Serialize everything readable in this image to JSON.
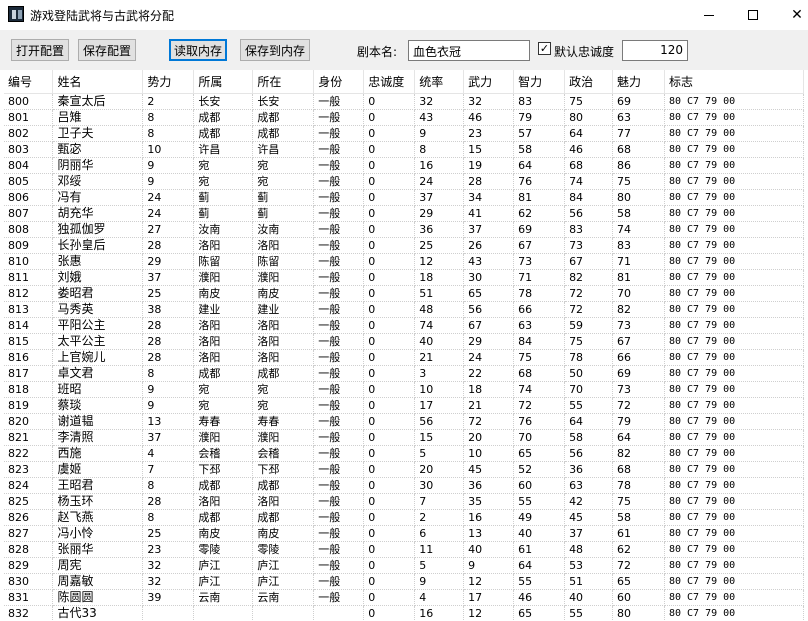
{
  "window": {
    "title": "游戏登陆武将与古武将分配"
  },
  "toolbar": {
    "open_config": "打开配置",
    "save_config": "保存配置",
    "read_memory": "读取内存",
    "save_to_memory": "保存到内存",
    "script_label": "剧本名:",
    "script_value": "血色衣冠",
    "default_loyalty_label": "默认忠诚度",
    "default_loyalty_checked": "✓",
    "default_loyalty_value": "120"
  },
  "table": {
    "columns": [
      "编号",
      "姓名",
      "势力",
      "所属",
      "所在",
      "身份",
      "忠诚度",
      "统率",
      "武力",
      "智力",
      "政治",
      "魅力",
      "标志"
    ],
    "rows": [
      [
        "800",
        "秦宣太后",
        "2",
        "长安",
        "长安",
        "一般",
        "0",
        "32",
        "32",
        "83",
        "75",
        "69",
        "80 C7 79 00"
      ],
      [
        "801",
        "吕雉",
        "8",
        "成都",
        "成都",
        "一般",
        "0",
        "43",
        "46",
        "79",
        "80",
        "63",
        "80 C7 79 00"
      ],
      [
        "802",
        "卫子夫",
        "8",
        "成都",
        "成都",
        "一般",
        "0",
        "9",
        "23",
        "57",
        "64",
        "77",
        "80 C7 79 00"
      ],
      [
        "803",
        "甄宓",
        "10",
        "许昌",
        "许昌",
        "一般",
        "0",
        "8",
        "15",
        "58",
        "46",
        "68",
        "80 C7 79 00"
      ],
      [
        "804",
        "阴丽华",
        "9",
        "宛",
        "宛",
        "一般",
        "0",
        "16",
        "19",
        "64",
        "68",
        "86",
        "80 C7 79 00"
      ],
      [
        "805",
        "邓绥",
        "9",
        "宛",
        "宛",
        "一般",
        "0",
        "24",
        "28",
        "76",
        "74",
        "75",
        "80 C7 79 00"
      ],
      [
        "806",
        "冯有",
        "24",
        "蓟",
        "蓟",
        "一般",
        "0",
        "37",
        "34",
        "81",
        "84",
        "80",
        "80 C7 79 00"
      ],
      [
        "807",
        "胡充华",
        "24",
        "蓟",
        "蓟",
        "一般",
        "0",
        "29",
        "41",
        "62",
        "56",
        "58",
        "80 C7 79 00"
      ],
      [
        "808",
        "独孤伽罗",
        "27",
        "汝南",
        "汝南",
        "一般",
        "0",
        "36",
        "37",
        "69",
        "83",
        "74",
        "80 C7 79 00"
      ],
      [
        "809",
        "长孙皇后",
        "28",
        "洛阳",
        "洛阳",
        "一般",
        "0",
        "25",
        "26",
        "67",
        "73",
        "83",
        "80 C7 79 00"
      ],
      [
        "810",
        "张惠",
        "29",
        "陈留",
        "陈留",
        "一般",
        "0",
        "12",
        "43",
        "73",
        "67",
        "71",
        "80 C7 79 00"
      ],
      [
        "811",
        "刘娥",
        "37",
        "濮阳",
        "濮阳",
        "一般",
        "0",
        "18",
        "30",
        "71",
        "82",
        "81",
        "80 C7 79 00"
      ],
      [
        "812",
        "娄昭君",
        "25",
        "南皮",
        "南皮",
        "一般",
        "0",
        "51",
        "65",
        "78",
        "72",
        "70",
        "80 C7 79 00"
      ],
      [
        "813",
        "马秀英",
        "38",
        "建业",
        "建业",
        "一般",
        "0",
        "48",
        "56",
        "66",
        "72",
        "82",
        "80 C7 79 00"
      ],
      [
        "814",
        "平阳公主",
        "28",
        "洛阳",
        "洛阳",
        "一般",
        "0",
        "74",
        "67",
        "63",
        "59",
        "73",
        "80 C7 79 00"
      ],
      [
        "815",
        "太平公主",
        "28",
        "洛阳",
        "洛阳",
        "一般",
        "0",
        "40",
        "29",
        "84",
        "75",
        "67",
        "80 C7 79 00"
      ],
      [
        "816",
        "上官婉儿",
        "28",
        "洛阳",
        "洛阳",
        "一般",
        "0",
        "21",
        "24",
        "75",
        "78",
        "66",
        "80 C7 79 00"
      ],
      [
        "817",
        "卓文君",
        "8",
        "成都",
        "成都",
        "一般",
        "0",
        "3",
        "22",
        "68",
        "50",
        "69",
        "80 C7 79 00"
      ],
      [
        "818",
        "班昭",
        "9",
        "宛",
        "宛",
        "一般",
        "0",
        "10",
        "18",
        "74",
        "70",
        "73",
        "80 C7 79 00"
      ],
      [
        "819",
        "蔡琰",
        "9",
        "宛",
        "宛",
        "一般",
        "0",
        "17",
        "21",
        "72",
        "55",
        "72",
        "80 C7 79 00"
      ],
      [
        "820",
        "谢道韫",
        "13",
        "寿春",
        "寿春",
        "一般",
        "0",
        "56",
        "72",
        "76",
        "64",
        "79",
        "80 C7 79 00"
      ],
      [
        "821",
        "李清照",
        "37",
        "濮阳",
        "濮阳",
        "一般",
        "0",
        "15",
        "20",
        "70",
        "58",
        "64",
        "80 C7 79 00"
      ],
      [
        "822",
        "西施",
        "4",
        "会稽",
        "会稽",
        "一般",
        "0",
        "5",
        "10",
        "65",
        "56",
        "82",
        "80 C7 79 00"
      ],
      [
        "823",
        "虞姬",
        "7",
        "下邳",
        "下邳",
        "一般",
        "0",
        "20",
        "45",
        "52",
        "36",
        "68",
        "80 C7 79 00"
      ],
      [
        "824",
        "王昭君",
        "8",
        "成都",
        "成都",
        "一般",
        "0",
        "30",
        "36",
        "60",
        "63",
        "78",
        "80 C7 79 00"
      ],
      [
        "825",
        "杨玉环",
        "28",
        "洛阳",
        "洛阳",
        "一般",
        "0",
        "7",
        "35",
        "55",
        "42",
        "75",
        "80 C7 79 00"
      ],
      [
        "826",
        "赵飞燕",
        "8",
        "成都",
        "成都",
        "一般",
        "0",
        "2",
        "16",
        "49",
        "45",
        "58",
        "80 C7 79 00"
      ],
      [
        "827",
        "冯小怜",
        "25",
        "南皮",
        "南皮",
        "一般",
        "0",
        "6",
        "13",
        "40",
        "37",
        "61",
        "80 C7 79 00"
      ],
      [
        "828",
        "张丽华",
        "23",
        "零陵",
        "零陵",
        "一般",
        "0",
        "11",
        "40",
        "61",
        "48",
        "62",
        "80 C7 79 00"
      ],
      [
        "829",
        "周宪",
        "32",
        "庐江",
        "庐江",
        "一般",
        "0",
        "5",
        "9",
        "64",
        "53",
        "72",
        "80 C7 79 00"
      ],
      [
        "830",
        "周嘉敏",
        "32",
        "庐江",
        "庐江",
        "一般",
        "0",
        "9",
        "12",
        "55",
        "51",
        "65",
        "80 C7 79 00"
      ],
      [
        "831",
        "陈圆圆",
        "39",
        "云南",
        "云南",
        "一般",
        "0",
        "4",
        "17",
        "46",
        "40",
        "60",
        "80 C7 79 00"
      ],
      [
        "832",
        "古代33",
        "",
        "",
        "",
        "",
        "0",
        "16",
        "12",
        "65",
        "55",
        "80",
        "80 C7 79 00"
      ]
    ]
  }
}
